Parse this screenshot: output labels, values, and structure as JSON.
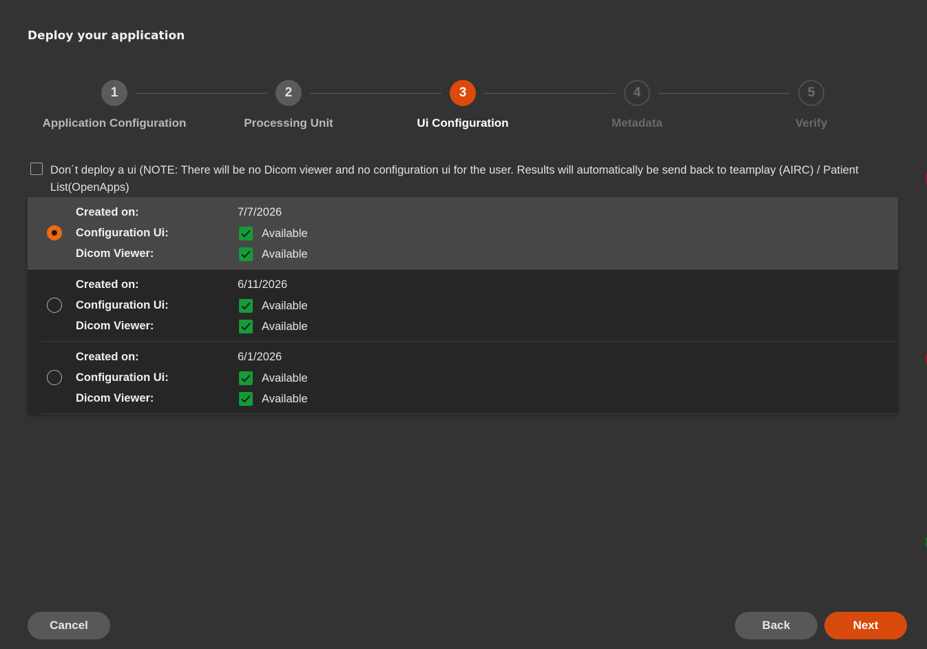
{
  "dialog": {
    "title": "Deploy your application"
  },
  "stepper": {
    "steps": [
      {
        "number": "1",
        "label": "Application Configuration",
        "state": "done"
      },
      {
        "number": "2",
        "label": "Processing Unit",
        "state": "done"
      },
      {
        "number": "3",
        "label": "Ui Configuration",
        "state": "active"
      },
      {
        "number": "4",
        "label": "Metadata",
        "state": "future"
      },
      {
        "number": "5",
        "label": "Verify",
        "state": "future"
      }
    ]
  },
  "no_ui_option": {
    "checked": false,
    "label": "Don´t deploy a ui (NOTE: There will be no Dicom viewer and no configuration ui for the user. Results will automatically be send back to teamplay (AIRC) / Patient List(OpenApps)"
  },
  "versions": {
    "labels": {
      "created_on": "Created on:",
      "configuration_ui": "Configuration Ui:",
      "dicom_viewer": "Dicom Viewer:"
    },
    "items": [
      {
        "selected": true,
        "created_on": "7/7/2026",
        "configuration_ui": "Available",
        "dicom_viewer": "Available"
      },
      {
        "selected": false,
        "created_on": "6/11/2026",
        "configuration_ui": "Available",
        "dicom_viewer": "Available"
      },
      {
        "selected": false,
        "created_on": "6/1/2026",
        "configuration_ui": "Available",
        "dicom_viewer": "Available"
      }
    ]
  },
  "footer": {
    "cancel_label": "Cancel",
    "back_label": "Back",
    "next_label": "Next"
  },
  "colors": {
    "background": "#333333",
    "accent": "#dc4a0c",
    "radio_selected": "#ec6a10",
    "available_check": "#159a39",
    "list_background": "#262626",
    "selected_row": "#474747"
  },
  "icons": {
    "radio_selected": "radio-selected-icon",
    "radio_unselected": "radio-unselected-icon",
    "available": "checkmark-icon",
    "unchecked_box": "checkbox-unchecked-icon"
  }
}
